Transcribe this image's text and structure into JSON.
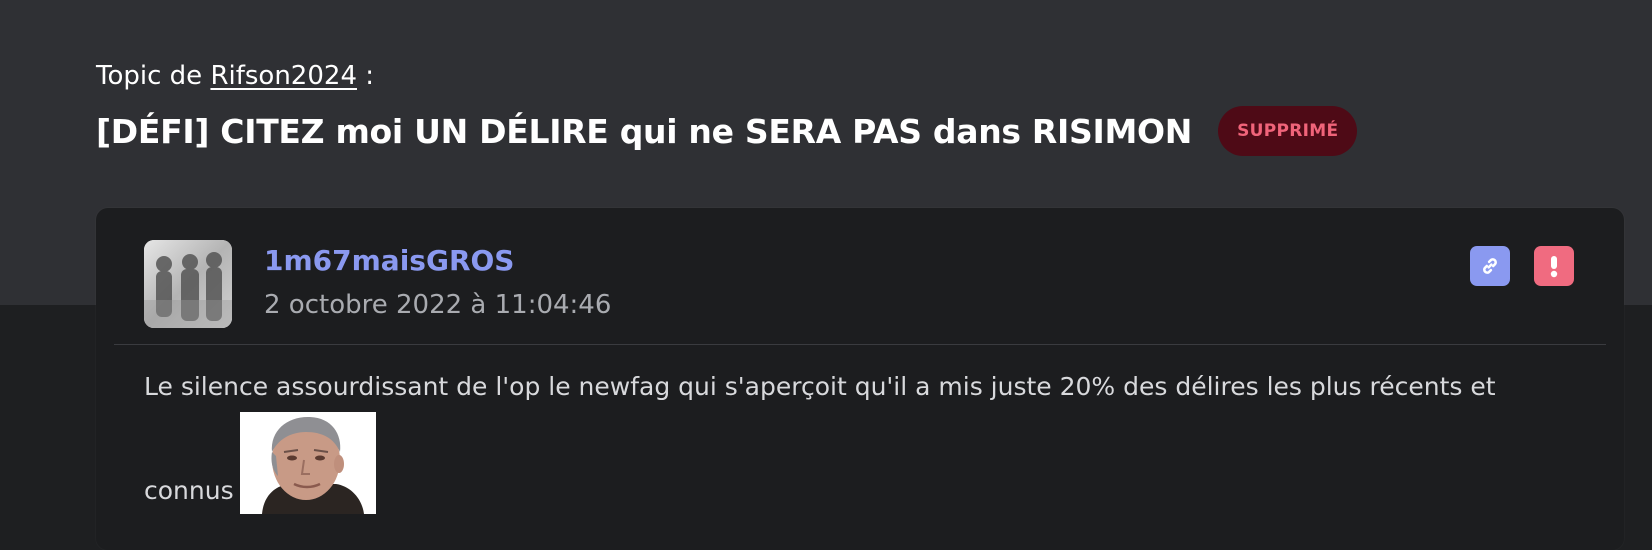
{
  "topic": {
    "prefix": "Topic de",
    "author": "Rifson2024",
    "suffix": ":",
    "title": "[DÉFI] CITEZ moi UN DÉLIRE qui ne SERA PAS dans RISIMON",
    "status": "SUPPRIMÉ"
  },
  "post": {
    "author": "1m67maisGROS",
    "date": "2 octobre 2022 à 11:04:46",
    "body_line1": "Le silence assourdissant de l'op le newfag qui s'aperçoit qu'il a mis juste 20% des délires les plus récents et",
    "body_line2": "connus",
    "icons": {
      "permalink": "link-icon",
      "report": "exclamation-icon"
    }
  },
  "colors": {
    "accent": "#8a99f0",
    "danger": "#f06b80",
    "badge_bg": "#4e0a16",
    "badge_text": "#f0647a"
  }
}
